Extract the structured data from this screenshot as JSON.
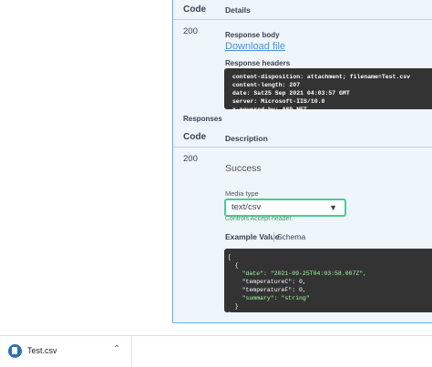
{
  "table_header": {
    "code": "Code",
    "details": "Details"
  },
  "response_entry": {
    "code": "200",
    "body_label": "Response body",
    "download_link": "Download file",
    "headers_label": "Response headers",
    "headers_lines": [
      "content-disposition: attachment; filename=Test.csv",
      "content-length: 207",
      "date: Sat25 Sep 2021 04:03:57 GMT",
      "server: Microsoft-IIS/10.0",
      "x-powered-by: ASP.NET"
    ]
  },
  "responses_section": {
    "title": "Responses",
    "code_header": "Code",
    "desc_header": "Description",
    "row": {
      "code": "200",
      "description": "Success",
      "media_type_label": "Media type",
      "media_type_value": "text/csv",
      "controls_text": "Controls Accept header.",
      "tab_example": "Example Value",
      "tab_schema": "Schema"
    },
    "example_lines": [
      "[",
      "  {",
      "    \"date\": \"2021-09-25T04:03:58.007Z\",",
      "    \"temperatureC\": 0,",
      "    \"temperatureF\": 0,",
      "    \"summary\": \"string\"",
      "  }",
      "]"
    ]
  },
  "download_bar": {
    "file_name": "Test.csv",
    "icon": "csv-file-icon",
    "chevron": "chevron-up-icon"
  }
}
